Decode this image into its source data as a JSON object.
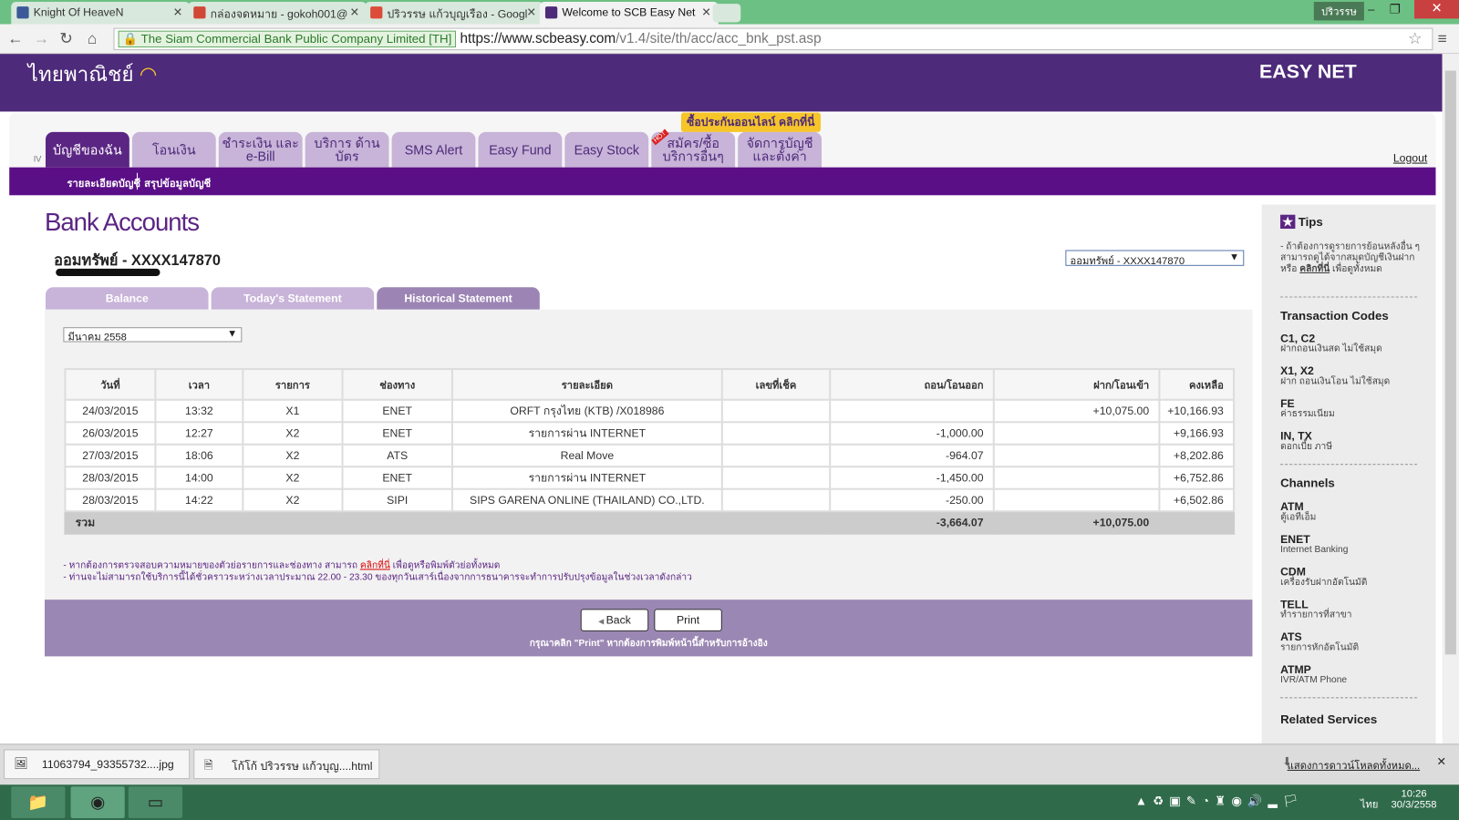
{
  "browser": {
    "tabs": [
      {
        "title": "Knight Of HeaveN",
        "color": "#3b5998"
      },
      {
        "title": "กล่องจดหมาย - gokoh001@",
        "color": "#d14836"
      },
      {
        "title": "ปริวรรษ แก้วบุญเรือง - Googl",
        "color": "#dd4b39"
      },
      {
        "title": "Welcome to SCB Easy Net",
        "color": "#4d2a7a"
      }
    ],
    "window_user": "ปริวรรษ",
    "ev_label": "The Siam Commercial Bank Public Company Limited [TH]",
    "url_host": "https://www.scbeasy.com",
    "url_path": "/v1.4/site/th/acc/acc_bnk_pst.asp"
  },
  "header": {
    "logo": "ไทยพาณิชย์",
    "brand": "EASY NET"
  },
  "menu": {
    "promo": "ซื้อประกันออนไลน์ คลิกที่นี่",
    "marker": "IV",
    "tabs": [
      "บัญชีของฉัน",
      "โอนเงิน",
      "ชำระเงิน และ e-Bill",
      "บริการ ด้านบัตร",
      "SMS Alert",
      "Easy Fund",
      "Easy Stock",
      "สมัคร/ซื้อ บริการอื่นๆ",
      "จัดการบัญชี และตั้งค่า"
    ],
    "hot": "HOT",
    "logout": "Logout",
    "sub": [
      "รายละเอียดบัญชี",
      "สรุปข้อมูลบัญชี"
    ]
  },
  "page": {
    "title": "Bank Accounts",
    "account": "ออมทรัพย์ - XXXX147870",
    "account_select": "ออมทรัพย์ - XXXX147870",
    "tabs": [
      "Balance",
      "Today's Statement",
      "Historical Statement"
    ],
    "month": "มีนาคม 2558"
  },
  "table": {
    "headers": [
      "วันที่",
      "เวลา",
      "รายการ",
      "ช่องทาง",
      "รายละเอียด",
      "เลขที่เช็ค",
      "ถอน/โอนออก",
      "ฝาก/โอนเข้า",
      "คงเหลือ"
    ],
    "rows": [
      [
        "24/03/2015",
        "13:32",
        "X1",
        "ENET",
        "ORFT กรุงไทย (KTB) /X018986",
        "",
        "",
        "+10,075.00",
        "+10,166.93"
      ],
      [
        "26/03/2015",
        "12:27",
        "X2",
        "ENET",
        "รายการผ่าน INTERNET",
        "",
        "-1,000.00",
        "",
        "+9,166.93"
      ],
      [
        "27/03/2015",
        "18:06",
        "X2",
        "ATS",
        "Real Move",
        "",
        "-964.07",
        "",
        "+8,202.86"
      ],
      [
        "28/03/2015",
        "14:00",
        "X2",
        "ENET",
        "รายการผ่าน INTERNET",
        "",
        "-1,450.00",
        "",
        "+6,752.86"
      ],
      [
        "28/03/2015",
        "14:22",
        "X2",
        "SIPI",
        "SIPS GARENA ONLINE (THAILAND) CO.,LTD.",
        "",
        "-250.00",
        "",
        "+6,502.86"
      ]
    ],
    "total_label": "รวม",
    "total_withdraw": "-3,664.07",
    "total_deposit": "+10,075.00"
  },
  "notes": {
    "n1a": "- หากต้องการตรวจสอบความหมายของตัวย่อรายการและช่องทาง สามารถ",
    "n1link": "คลิกที่นี่",
    "n1b": " เพื่อดูหรือพิมพ์ตัวย่อทั้งหมด",
    "n2": "- ท่านจะไม่สามารถใช้บริการนี้ได้ชั่วคราวระหว่างเวลาประมาณ 22.00 - 23.30 ของทุกวันเสาร์เนื่องจากการธนาคารจะทำการปรับปรุงข้อมูลในช่วงเวลาดังกล่าว"
  },
  "footer": {
    "back": "Back",
    "print": "Print",
    "hint": "กรุณาคลิก \"Print\" หากต้องการพิมพ์หน้านี้สำหรับการอ้างอิง"
  },
  "sidebar": {
    "tips_title": "Tips",
    "tips_text": "- ถ้าต้องการดูรายการย้อนหลังอื่น ๆ สามารถดูได้จากสมุดบัญชีเงินฝาก หรือ",
    "tips_link": "คลิกที่นี่",
    "tips_tail": " เพื่อดูทั้งหมด",
    "codes_title": "Transaction Codes",
    "codes": [
      {
        "code": "C1, C2",
        "desc": "ฝากถอนเงินสด ไม่ใช้สมุด"
      },
      {
        "code": "X1, X2",
        "desc": "ฝาก ถอนเงินโอน ไม่ใช้สมุด"
      },
      {
        "code": "FE",
        "desc": "ค่าธรรมเนียม"
      },
      {
        "code": "IN, TX",
        "desc": "ดอกเบี้ย ภาษี"
      }
    ],
    "channels_title": "Channels",
    "channels": [
      {
        "code": "ATM",
        "desc": "ตู้เอทีเอ็ม"
      },
      {
        "code": "ENET",
        "desc": "Internet Banking"
      },
      {
        "code": "CDM",
        "desc": "เครื่องรับฝากอัตโนมัติ"
      },
      {
        "code": "TELL",
        "desc": "ทำรายการที่สาขา"
      },
      {
        "code": "ATS",
        "desc": "รายการหักอัตโนมัติ"
      },
      {
        "code": "ATMP",
        "desc": "IVR/ATM Phone"
      }
    ],
    "related_title": "Related Services"
  },
  "downloads": {
    "items": [
      "11063794_93355732....jpg",
      "โก้โก้ ปริวรรษ แก้วบุญ....html"
    ],
    "show_all": "แสดงการดาวน์โหลดทั้งหมด..."
  },
  "taskbar": {
    "lang": "ไทย",
    "time": "10:26",
    "date": "30/3/2558"
  }
}
